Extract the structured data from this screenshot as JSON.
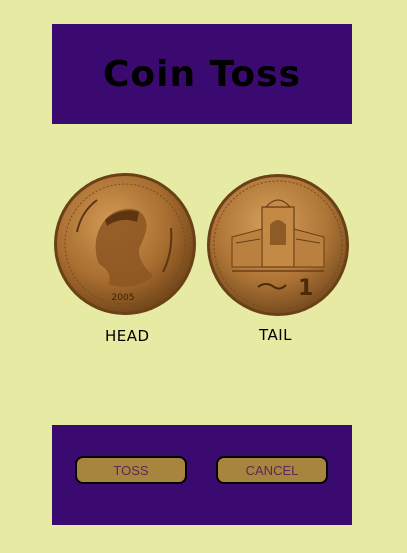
{
  "header": {
    "title": "Coin Toss"
  },
  "coins": {
    "head": {
      "label": "HEAD",
      "year": "2005"
    },
    "tail": {
      "label": "TAIL",
      "value": "1"
    }
  },
  "footer": {
    "toss_label": "TOSS",
    "cancel_label": "CANCEL"
  },
  "colors": {
    "background": "#e6eaa3",
    "panel": "#3b0a70",
    "button": "#a8843f",
    "button_text": "#5a2a52",
    "coin": "#b07a3a"
  }
}
